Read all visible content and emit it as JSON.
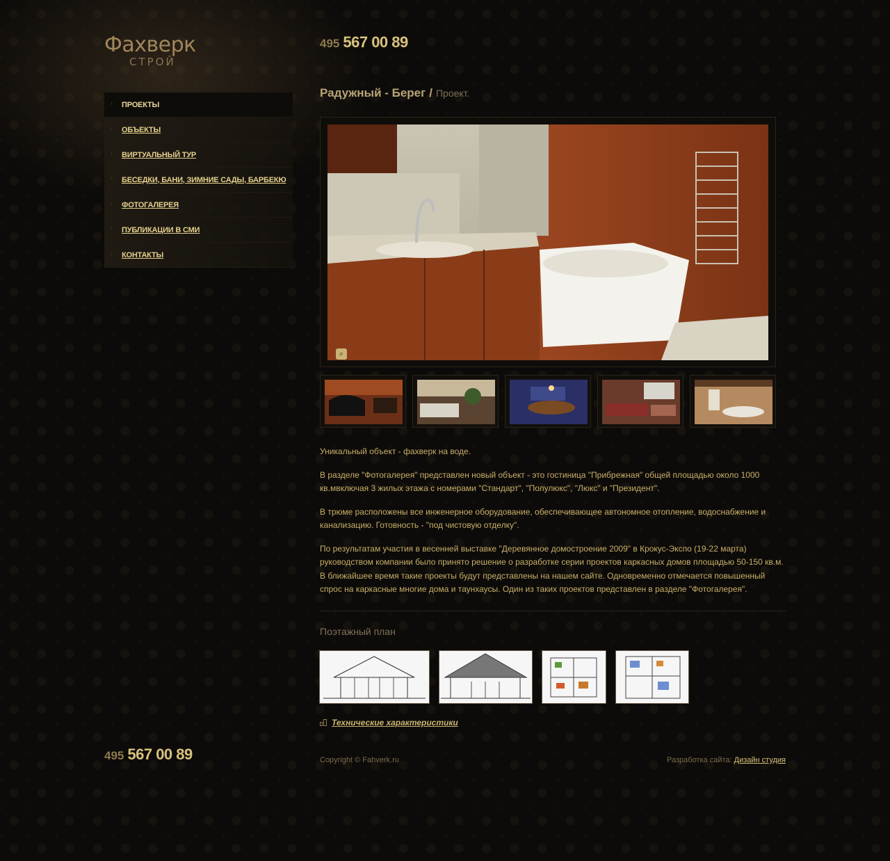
{
  "logo": {
    "title": "Фахверк",
    "subtitle": "строй"
  },
  "phone": {
    "code": "495",
    "number": "567 00 89"
  },
  "nav": {
    "items": [
      {
        "label": "Проекты",
        "active": true
      },
      {
        "label": "Объекты"
      },
      {
        "label": "Виртуальный тур"
      },
      {
        "label": "Беседки, бани, зимние сады, барбекю"
      },
      {
        "label": "Фотогалерея"
      },
      {
        "label": "Публикации в СМИ"
      },
      {
        "label": "Контакты"
      }
    ]
  },
  "page": {
    "title": "Радужный - Берег",
    "separator": "/",
    "subtitle": "Проект."
  },
  "gallery": {
    "main_photo": "bathroom-photo",
    "zoom_icon": "zoom-icon",
    "thumbnails": [
      "piano-room",
      "living-room-sofa",
      "dining-room",
      "living-room-fireplace",
      "lounge-hall"
    ]
  },
  "content": {
    "paragraphs": [
      "Уникальный объект - фахверк на воде.",
      "В разделе \"Фотогалерея\" представлен новый объект - это гостиница \"Прибрежная\" общей площадью около 1000 кв.мвключая 3 жилых этажа с номерами \"Стандарт\", \"Полулюкс\", \"Люкс\" и \"Президент\".",
      "В трюме расположены все инженерное оборудование, обеспечивающее автономное отопление, водоснабжение и канализацию. Готовность - \"под чистовую отделку\".",
      "По результатам участия в весенней выставке \"Деревянное домостроение 2009\" в Крокус-Экспо (19-22 марта) руководством компании было принято решение о разработке серии проектов каркасных домов площадью 50-150 кв.м. В ближайшее время такие проекты будут представлены на нашем сайте. Одновременно отмечается повышенный спрос на каркасные многие дома и таунхаусы. Один из таких проектов представлен в разделе \"Фотогалерея\"."
    ]
  },
  "floor_plan": {
    "title": "Поэтажный план",
    "images": [
      "facade-drawing-1",
      "facade-drawing-2",
      "floor-plan-1",
      "floor-plan-2"
    ]
  },
  "tech": {
    "label": "Технические характеристики"
  },
  "footer": {
    "copyright": "Copyright © Fahverk.ru",
    "dev_prefix": "Разработка сайта:",
    "dev_link": "Дизайн студия"
  },
  "colors": {
    "background": "#0d0b09",
    "accent": "#d9c27e",
    "text": "#c8b06a"
  }
}
